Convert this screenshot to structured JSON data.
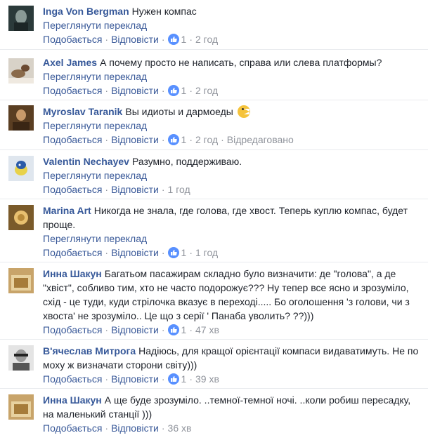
{
  "labels": {
    "see_translation": "Переглянути переклад",
    "like": "Подобається",
    "reply": "Відповісти",
    "edited": "Відредаговано"
  },
  "comments": [
    {
      "author": "Inga Von Bergman",
      "text": "Нужен компас",
      "likes": "1",
      "time": "2 год",
      "has_translation": true
    },
    {
      "author": "Axel James",
      "text": "А почему просто не написать, справа или слева платформы?",
      "likes": "1",
      "time": "2 год",
      "has_translation": true
    },
    {
      "author": "Myroslav Taranik",
      "text": "Вы идиоты и дармоеды",
      "emoji": "pacman-emoji",
      "likes": "1",
      "time": "2 год",
      "edited": true,
      "has_translation": true
    },
    {
      "author": "Valentin Nechayev",
      "text": "Разумно, поддерживаю.",
      "likes": null,
      "time": "1 год",
      "has_translation": true
    },
    {
      "author": "Marina Art",
      "text": "Никогда не знала, где голова, где хвост. Теперь куплю компас, будет проще.",
      "likes": "1",
      "time": "1 год",
      "has_translation": true
    },
    {
      "author": "Инна Шакун",
      "text": "Багатьом пасажирам складно було визначити: де \"голова\", а де \"хвіст\", собливо тим, хто не часто подорожує??? Ну тепер все ясно и зрозуміло, схід - це туди, куди стрілочка вказує в переході..... Бо оголошення 'з голови, чи з хвоста' не зрозуміло.. Це що з серії ' Панаба уволить? ??)))",
      "likes": "1",
      "time": "47 хв",
      "has_translation": false
    },
    {
      "author": "В'ячеслав Митрога",
      "text": "Надіюсь, для кращої орієнтації компаси видаватимуть. Не по моху ж визначати сторони світу)))",
      "likes": "1",
      "time": "39 хв",
      "has_translation": false
    },
    {
      "author": "Инна Шакун",
      "text": "А ще буде зрозуміло. ..темної-темної ночі. ..коли робиш пересадку, на маленький станції )))",
      "likes": null,
      "time": "36 хв",
      "has_translation": false
    }
  ],
  "colors": {
    "link": "#385898",
    "author": "#365899",
    "meta": "#90949c",
    "like_badge": "#5890ff"
  }
}
